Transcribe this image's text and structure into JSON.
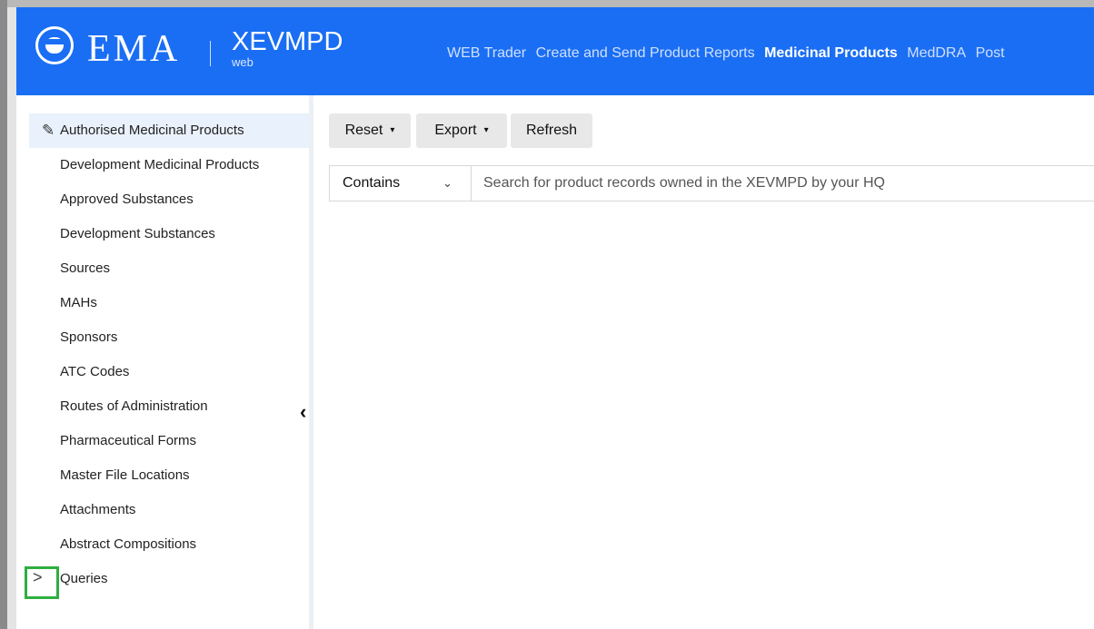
{
  "header": {
    "brand": "EMA",
    "app_name": "XEVMPD",
    "app_sub": "web",
    "nav": [
      {
        "label": "WEB Trader",
        "active": false
      },
      {
        "label": "Create and Send Product Reports",
        "active": false
      },
      {
        "label": "Medicinal Products",
        "active": true
      },
      {
        "label": "MedDRA",
        "active": false
      },
      {
        "label": "Post",
        "active": false
      }
    ]
  },
  "sidebar": {
    "items": [
      {
        "label": "Authorised Medicinal Products",
        "active": true
      },
      {
        "label": "Development Medicinal Products"
      },
      {
        "label": "Approved Substances"
      },
      {
        "label": "Development Substances"
      },
      {
        "label": "Sources"
      },
      {
        "label": "MAHs"
      },
      {
        "label": "Sponsors"
      },
      {
        "label": "ATC Codes"
      },
      {
        "label": "Routes of Administration"
      },
      {
        "label": "Pharmaceutical Forms"
      },
      {
        "label": "Master File Locations"
      },
      {
        "label": "Attachments"
      },
      {
        "label": "Abstract Compositions"
      },
      {
        "label": "Queries"
      }
    ],
    "collapse_glyph": "‹",
    "expand_glyph": ">"
  },
  "toolbar": {
    "reset_label": "Reset",
    "export_label": "Export",
    "refresh_label": "Refresh",
    "caret": "▾"
  },
  "search": {
    "mode": "Contains",
    "mode_chevron": "⌄",
    "placeholder": "Search for product records owned in the XEVMPD by your HQ"
  },
  "colors": {
    "header_bg": "#1a6ef4",
    "active_item_bg": "#e9f1fc",
    "highlight_box": "#2eaf3f"
  }
}
